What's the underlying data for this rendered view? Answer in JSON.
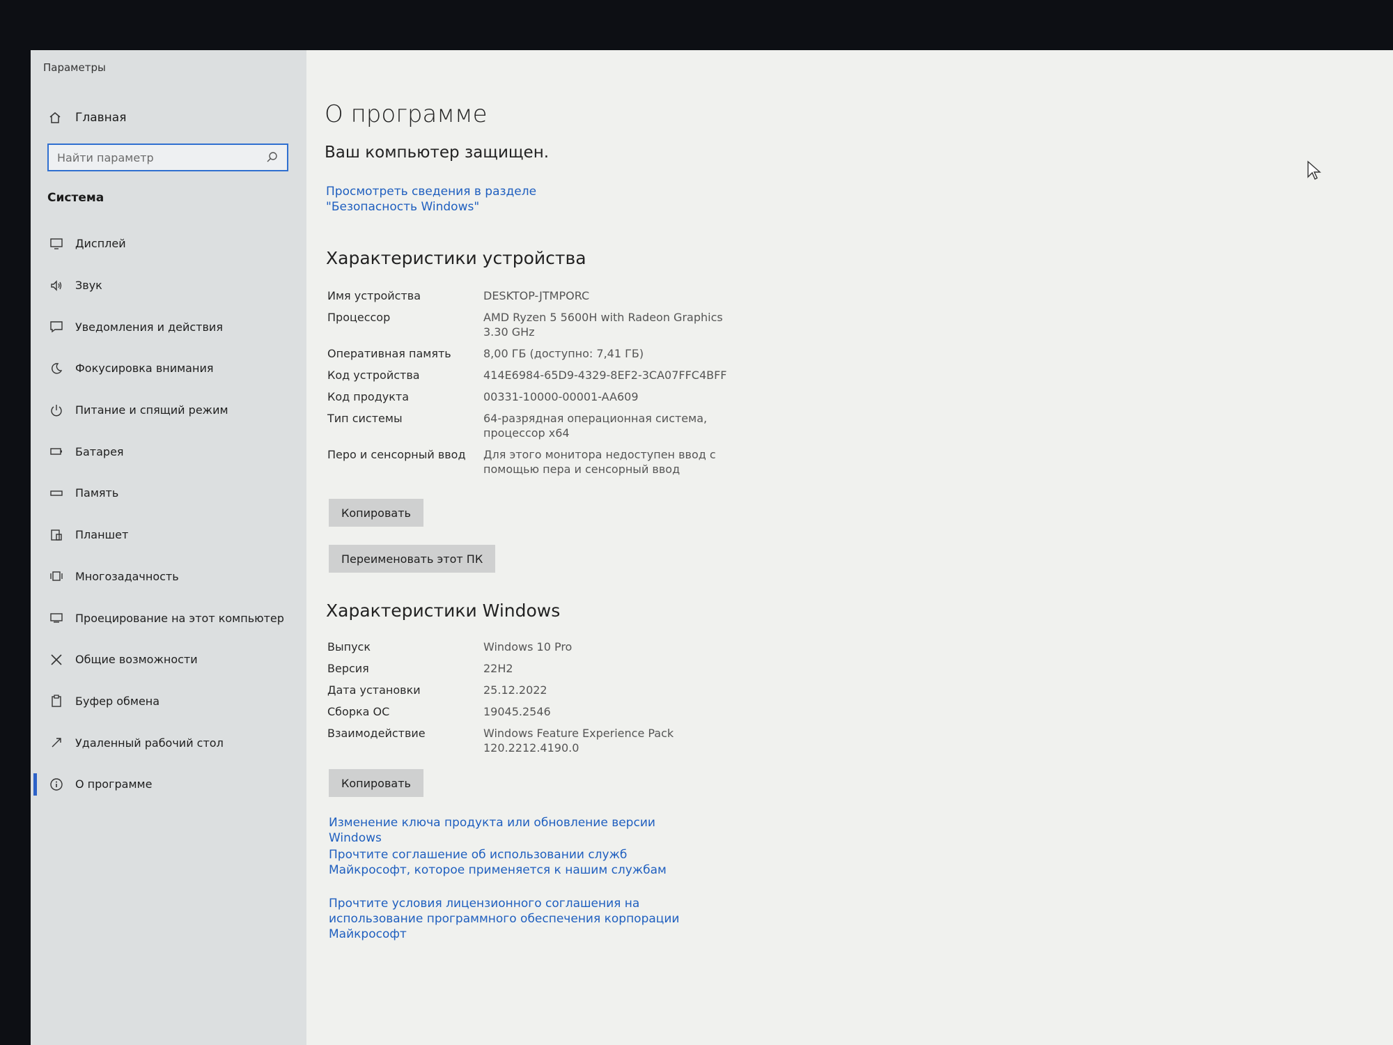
{
  "window": {
    "title": "Параметры"
  },
  "sidebar": {
    "home_label": "Главная",
    "search_placeholder": "Найти параметр",
    "section_title": "Система",
    "items": [
      {
        "label": "Дисплей",
        "icon": "monitor-icon"
      },
      {
        "label": "Звук",
        "icon": "speaker-icon"
      },
      {
        "label": "Уведомления и действия",
        "icon": "notification-icon"
      },
      {
        "label": "Фокусировка внимания",
        "icon": "moon-icon"
      },
      {
        "label": "Питание и спящий режим",
        "icon": "power-icon"
      },
      {
        "label": "Батарея",
        "icon": "battery-icon"
      },
      {
        "label": "Память",
        "icon": "storage-icon"
      },
      {
        "label": "Планшет",
        "icon": "tablet-icon"
      },
      {
        "label": "Многозадачность",
        "icon": "multitasking-icon"
      },
      {
        "label": "Проецирование на этот компьютер",
        "icon": "projection-icon"
      },
      {
        "label": "Общие возможности",
        "icon": "shared-experiences-icon"
      },
      {
        "label": "Буфер обмена",
        "icon": "clipboard-icon"
      },
      {
        "label": "Удаленный рабочий стол",
        "icon": "remote-desktop-icon"
      },
      {
        "label": "О программе",
        "icon": "info-icon",
        "active": true
      }
    ]
  },
  "main": {
    "title": "О программе",
    "protected_text": "Ваш компьютер защищен.",
    "security_link": "Просмотреть сведения в разделе \"Безопасность Windows\"",
    "device_section_title": "Характеристики устройства",
    "device_specs": [
      {
        "label": "Имя устройства",
        "value": "DESKTOP-JTMPORC"
      },
      {
        "label": "Процессор",
        "value": "AMD Ryzen 5 5600H with Radeon Graphics 3.30 GHz"
      },
      {
        "label": "Оперативная память",
        "value": "8,00 ГБ (доступно: 7,41 ГБ)"
      },
      {
        "label": "Код устройства",
        "value": "414E6984-65D9-4329-8EF2-3CA07FFC4BFF"
      },
      {
        "label": "Код продукта",
        "value": "00331-10000-00001-AA609"
      },
      {
        "label": "Тип системы",
        "value": "64-разрядная операционная система, процессор x64"
      },
      {
        "label": "Перо и сенсорный ввод",
        "value": "Для этого монитора недоступен ввод с помощью пера и сенсорный ввод"
      }
    ],
    "copy_label": "Копировать",
    "rename_label": "Переименовать этот ПК",
    "windows_section_title": "Характеристики Windows",
    "windows_specs": [
      {
        "label": "Выпуск",
        "value": "Windows 10 Pro"
      },
      {
        "label": "Версия",
        "value": "22H2"
      },
      {
        "label": "Дата установки",
        "value": "25.12.2022"
      },
      {
        "label": "Сборка ОС",
        "value": "19045.2546"
      },
      {
        "label": "Взаимодействие",
        "value": "Windows Feature Experience Pack 120.2212.4190.0"
      }
    ],
    "copy2_label": "Копировать",
    "links": [
      "Изменение ключа продукта или обновление версии Windows",
      "Прочтите соглашение об использовании служб Майкрософт, которое применяется к нашим службам",
      "Прочтите условия лицензионного соглашения на использование программного обеспечения корпорации Майкрософт"
    ]
  },
  "colors": {
    "accent": "#2f6fd0",
    "link": "#1f5fbf",
    "sidebar_bg": "#dcdfe0",
    "content_bg": "#f0f1ee"
  }
}
